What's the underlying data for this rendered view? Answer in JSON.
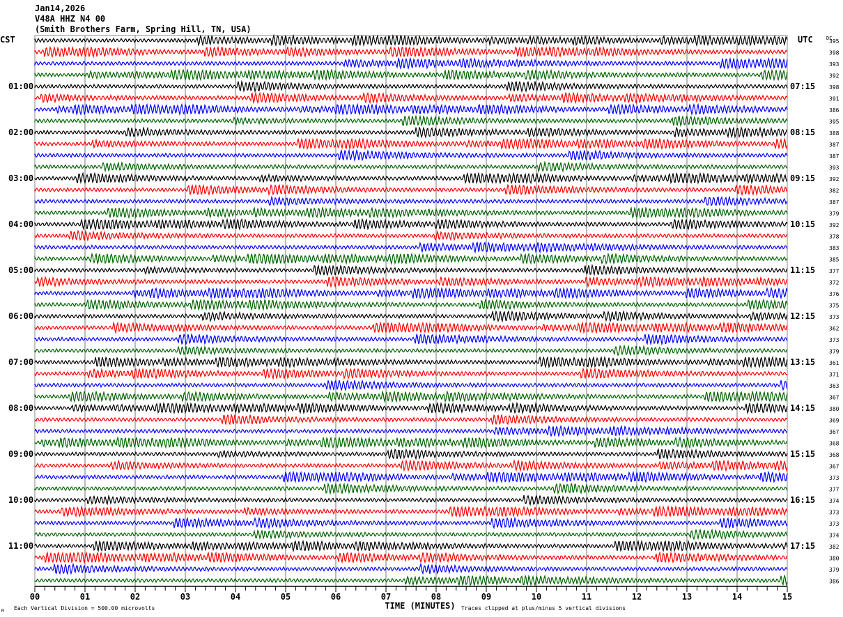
{
  "header": {
    "date": "Jan14,2026",
    "station": "V48A HHZ N4 00",
    "location": "(Smith Brothers Farm, Spring Hill, TN, USA)"
  },
  "chart_data": {
    "type": "line",
    "title": "Helicorder seismogram",
    "left_timezone": "CST",
    "right_timezone": "UTC",
    "dc_label": "DC",
    "xlabel": "TIME (MINUTES)",
    "x_ticks": [
      "00",
      "01",
      "02",
      "03",
      "04",
      "05",
      "06",
      "07",
      "08",
      "09",
      "10",
      "11",
      "12",
      "13",
      "14",
      "15"
    ],
    "xlim": [
      0,
      15
    ],
    "rows_per_hour": 4,
    "trace_colors": [
      "#000000",
      "#ff0000",
      "#0000ff",
      "#006400"
    ],
    "left_hour_labels": [
      "",
      "01:00",
      "02:00",
      "03:00",
      "04:00",
      "05:00",
      "06:00",
      "07:00",
      "08:00",
      "09:00",
      "10:00",
      "11:00"
    ],
    "right_hour_labels": [
      "",
      "07:15",
      "08:15",
      "09:15",
      "10:15",
      "11:15",
      "12:15",
      "13:15",
      "14:15",
      "15:15",
      "16:15",
      "17:15"
    ],
    "dc_values": [
      "395",
      "398",
      "393",
      "392",
      "398",
      "391",
      "386",
      "395",
      "388",
      "387",
      "387",
      "393",
      "392",
      "382",
      "387",
      "379",
      "392",
      "378",
      "383",
      "385",
      "377",
      "372",
      "376",
      "375",
      "373",
      "362",
      "373",
      "379",
      "361",
      "371",
      "363",
      "367",
      "380",
      "369",
      "367",
      "368",
      "368",
      "367",
      "373",
      "377",
      "374",
      "373",
      "373",
      "374",
      "382",
      "380",
      "379",
      "386"
    ],
    "scale_note": "Each Vertical Division =  500.00 microvolts",
    "clip_note": "Traces clipped at plus/minus 5 vertical divisions",
    "corner_mark": "M"
  }
}
